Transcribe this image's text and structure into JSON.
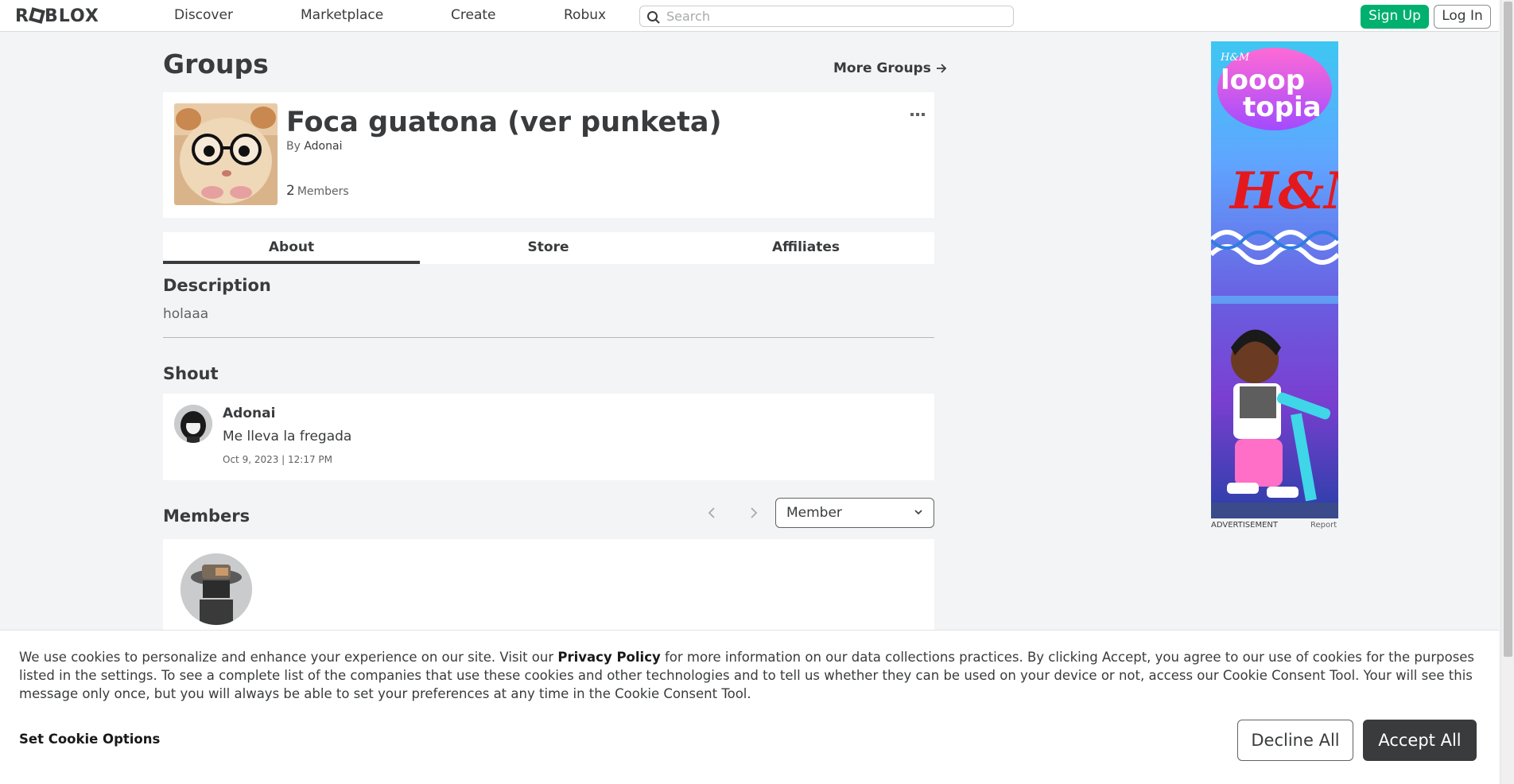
{
  "header": {
    "logo_text": "ROBLOX",
    "nav": [
      "Discover",
      "Marketplace",
      "Create",
      "Robux"
    ],
    "search_placeholder": "Search",
    "signup_label": "Sign Up",
    "login_label": "Log In"
  },
  "page": {
    "title": "Groups",
    "more_groups": "More Groups"
  },
  "group": {
    "name": "Foca guatona (ver punketa)",
    "by_label": "By",
    "owner": "Adonai",
    "member_count": "2",
    "members_label": "Members"
  },
  "tabs": [
    {
      "label": "About",
      "active": true
    },
    {
      "label": "Store",
      "active": false
    },
    {
      "label": "Affiliates",
      "active": false
    }
  ],
  "about": {
    "description_heading": "Description",
    "description": "holaaa",
    "shout_heading": "Shout",
    "shout": {
      "user": "Adonai",
      "message": "Me lleva la fregada",
      "date": "Oct 9, 2023 | 12:17 PM"
    },
    "members_heading": "Members",
    "role_selected": "Member"
  },
  "ad": {
    "brand_small": "H&M",
    "headline_1": "looop",
    "headline_2": "topia",
    "brand_big": "H&M",
    "label": "ADVERTISEMENT",
    "report": "Report"
  },
  "cookie": {
    "text_before": "We use cookies to personalize and enhance your experience on our site. Visit our ",
    "privacy_link": "Privacy Policy",
    "text_after": " for more information on our data collections practices. By clicking Accept, you agree to our use of cookies for the purposes listed in the settings. To see a complete list of the companies that use these cookies and other technologies and to tell us whether they can be used on your device or not, access our Cookie Consent Tool. Your will see this message only once, but you will always be able to set your preferences at any time in the Cookie Consent Tool.",
    "set_options": "Set Cookie Options",
    "decline": "Decline All",
    "accept": "Accept All"
  },
  "colors": {
    "signup_green": "#00b06f",
    "accept_dark": "#393b3d",
    "background": "#f2f4f5"
  }
}
